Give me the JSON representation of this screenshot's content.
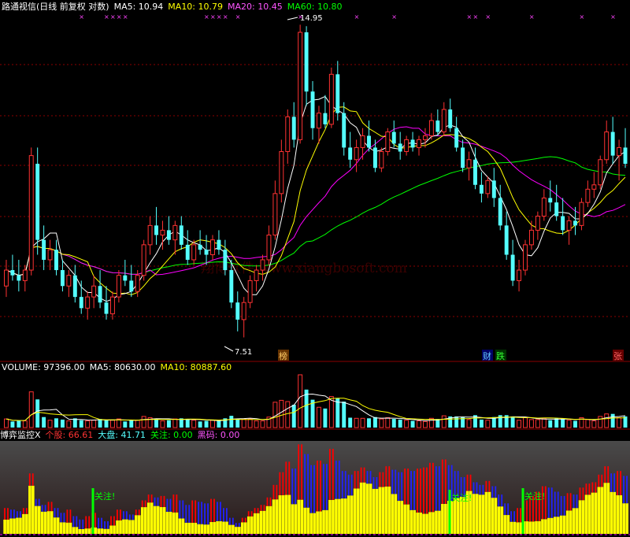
{
  "price_panel": {
    "title": "路通视信(日线 前复权 对数)",
    "ma5": "MA5: 10.94",
    "ma10": "MA10: 10.79",
    "ma20": "MA20: 10.45",
    "ma60": "MA60: 10.80",
    "high_label": "14.95",
    "low_label": "7.51",
    "watermark": "翔博软件 www.xiangbosoft.com",
    "event_labels": [
      "榜",
      "财",
      "跌",
      "张"
    ]
  },
  "volume_panel": {
    "vol": "VOLUME: 97396.00",
    "ma5": "MA5: 80630.00",
    "ma10": "MA10: 80887.60"
  },
  "indicator_panel": {
    "name": "博弈监控X",
    "stock": "个股: 66.61",
    "market": "大盘: 41.71",
    "focus": "关注: 0.00",
    "dark": "黑码: 0.00",
    "focus_tags": [
      "关注!",
      "关注!",
      "关注!"
    ]
  },
  "colors": {
    "up": "#ff3232",
    "down": "#54ffff",
    "ma5": "#ffffff",
    "ma10": "#ffff00",
    "ma20": "#ff00ff",
    "ma60": "#00ff00",
    "grid": "#8b0000",
    "indicator_yellow": "#ffff00",
    "indicator_red": "#ff0000",
    "indicator_blue": "#2222ff"
  },
  "chart_data": {
    "type": "candlestick",
    "series": [
      {
        "name": "MA5",
        "last": 10.94
      },
      {
        "name": "MA10",
        "last": 10.79
      },
      {
        "name": "MA20",
        "last": 10.45
      },
      {
        "name": "MA60",
        "last": 10.8
      }
    ],
    "price_high": 14.95,
    "price_low": 7.51,
    "scale": "log",
    "volume_last": 97396.0,
    "volume_ma5": 80630.0,
    "volume_ma10": 80887.6,
    "indicator": {
      "stock": 66.61,
      "market": 41.71,
      "focus": 0.0,
      "dark": 0.0
    },
    "candles": [
      [
        8.4,
        8.9,
        8.2,
        8.7
      ],
      [
        8.7,
        9.0,
        8.5,
        8.6
      ],
      [
        8.6,
        8.9,
        8.3,
        8.5
      ],
      [
        8.5,
        8.8,
        8.3,
        8.7
      ],
      [
        8.7,
        11.4,
        8.6,
        11.2
      ],
      [
        11.0,
        11.4,
        9.0,
        9.3
      ],
      [
        9.3,
        9.6,
        8.7,
        8.9
      ],
      [
        8.9,
        9.3,
        8.7,
        9.1
      ],
      [
        9.1,
        9.3,
        8.6,
        8.7
      ],
      [
        8.7,
        8.9,
        8.3,
        8.4
      ],
      [
        8.4,
        8.7,
        8.2,
        8.6
      ],
      [
        8.6,
        8.8,
        8.1,
        8.2
      ],
      [
        8.2,
        8.5,
        7.9,
        8.0
      ],
      [
        8.0,
        8.3,
        7.8,
        8.2
      ],
      [
        8.2,
        8.6,
        8.0,
        8.4
      ],
      [
        8.4,
        8.7,
        8.0,
        8.1
      ],
      [
        8.1,
        8.4,
        7.8,
        7.9
      ],
      [
        7.9,
        8.3,
        7.8,
        8.2
      ],
      [
        8.2,
        8.7,
        8.1,
        8.6
      ],
      [
        8.6,
        8.9,
        8.4,
        8.5
      ],
      [
        8.5,
        8.8,
        8.2,
        8.3
      ],
      [
        8.3,
        8.7,
        8.2,
        8.6
      ],
      [
        8.6,
        9.3,
        8.5,
        9.2
      ],
      [
        9.2,
        9.8,
        9.0,
        9.6
      ],
      [
        9.6,
        10.0,
        9.2,
        9.4
      ],
      [
        9.4,
        9.7,
        9.1,
        9.5
      ],
      [
        9.5,
        9.8,
        9.2,
        9.3
      ],
      [
        9.3,
        9.7,
        9.0,
        9.6
      ],
      [
        9.6,
        9.8,
        9.1,
        9.2
      ],
      [
        9.2,
        9.5,
        8.8,
        8.9
      ],
      [
        8.9,
        9.3,
        8.8,
        9.2
      ],
      [
        9.2,
        9.5,
        9.0,
        9.1
      ],
      [
        9.1,
        9.4,
        8.8,
        9.0
      ],
      [
        9.0,
        9.4,
        8.9,
        9.3
      ],
      [
        9.3,
        9.5,
        9.0,
        9.1
      ],
      [
        9.1,
        9.3,
        8.6,
        8.7
      ],
      [
        8.7,
        8.9,
        8.0,
        8.1
      ],
      [
        8.1,
        8.3,
        7.6,
        7.8
      ],
      [
        7.8,
        8.2,
        7.5,
        8.1
      ],
      [
        8.1,
        8.6,
        8.0,
        8.5
      ],
      [
        8.5,
        8.8,
        8.3,
        8.7
      ],
      [
        8.7,
        9.0,
        8.5,
        8.9
      ],
      [
        8.9,
        9.6,
        8.8,
        9.4
      ],
      [
        9.4,
        10.6,
        9.3,
        10.3
      ],
      [
        10.3,
        11.6,
        10.1,
        11.3
      ],
      [
        11.3,
        12.4,
        11.0,
        12.2
      ],
      [
        12.2,
        12.6,
        11.4,
        11.6
      ],
      [
        11.6,
        14.95,
        11.5,
        14.7
      ],
      [
        14.7,
        14.9,
        12.5,
        12.9
      ],
      [
        12.9,
        13.2,
        11.6,
        11.9
      ],
      [
        11.9,
        12.5,
        11.5,
        12.3
      ],
      [
        12.3,
        12.8,
        11.9,
        12.0
      ],
      [
        12.0,
        13.6,
        11.9,
        13.4
      ],
      [
        13.4,
        13.8,
        12.1,
        12.3
      ],
      [
        12.3,
        12.6,
        11.2,
        11.4
      ],
      [
        11.4,
        11.8,
        10.9,
        11.1
      ],
      [
        11.1,
        11.6,
        10.8,
        11.4
      ],
      [
        11.4,
        11.9,
        11.1,
        11.7
      ],
      [
        11.7,
        12.1,
        11.3,
        11.4
      ],
      [
        11.4,
        11.6,
        10.8,
        10.9
      ],
      [
        10.9,
        11.4,
        10.8,
        11.3
      ],
      [
        11.3,
        11.9,
        11.2,
        11.8
      ],
      [
        11.8,
        12.1,
        11.4,
        11.5
      ],
      [
        11.5,
        11.8,
        11.1,
        11.3
      ],
      [
        11.3,
        11.7,
        11.2,
        11.6
      ],
      [
        11.6,
        11.8,
        11.3,
        11.4
      ],
      [
        11.4,
        11.7,
        11.2,
        11.6
      ],
      [
        11.6,
        11.9,
        11.4,
        11.7
      ],
      [
        11.7,
        12.3,
        11.6,
        12.1
      ],
      [
        12.1,
        12.4,
        11.7,
        11.8
      ],
      [
        11.8,
        12.6,
        11.7,
        12.4
      ],
      [
        12.4,
        12.7,
        11.8,
        11.9
      ],
      [
        11.9,
        12.2,
        11.3,
        11.4
      ],
      [
        11.4,
        11.6,
        10.8,
        10.9
      ],
      [
        10.9,
        11.3,
        10.6,
        11.1
      ],
      [
        11.1,
        11.4,
        10.4,
        10.5
      ],
      [
        10.5,
        10.8,
        10.1,
        10.3
      ],
      [
        10.3,
        10.7,
        10.2,
        10.6
      ],
      [
        10.6,
        10.9,
        10.0,
        10.2
      ],
      [
        10.2,
        10.5,
        9.5,
        9.6
      ],
      [
        9.6,
        9.9,
        8.9,
        9.0
      ],
      [
        9.0,
        9.3,
        8.4,
        8.5
      ],
      [
        8.5,
        8.9,
        8.3,
        8.7
      ],
      [
        8.7,
        9.3,
        8.6,
        9.2
      ],
      [
        9.2,
        9.7,
        9.1,
        9.5
      ],
      [
        9.5,
        9.9,
        9.3,
        9.8
      ],
      [
        9.8,
        10.4,
        9.7,
        10.2
      ],
      [
        10.2,
        10.6,
        9.9,
        10.1
      ],
      [
        10.1,
        10.5,
        9.7,
        9.8
      ],
      [
        9.8,
        10.2,
        9.4,
        9.5
      ],
      [
        9.5,
        9.8,
        9.2,
        9.7
      ],
      [
        9.7,
        10.0,
        9.4,
        9.6
      ],
      [
        9.6,
        10.2,
        9.5,
        10.1
      ],
      [
        10.1,
        10.6,
        10.0,
        10.4
      ],
      [
        10.4,
        10.8,
        10.2,
        10.5
      ],
      [
        10.5,
        11.2,
        10.4,
        11.1
      ],
      [
        11.1,
        12.1,
        11.0,
        11.8
      ],
      [
        11.8,
        12.2,
        11.0,
        11.2
      ],
      [
        11.2,
        11.6,
        10.6,
        11.4
      ],
      [
        11.4,
        11.9,
        10.9,
        11.0
      ]
    ]
  }
}
